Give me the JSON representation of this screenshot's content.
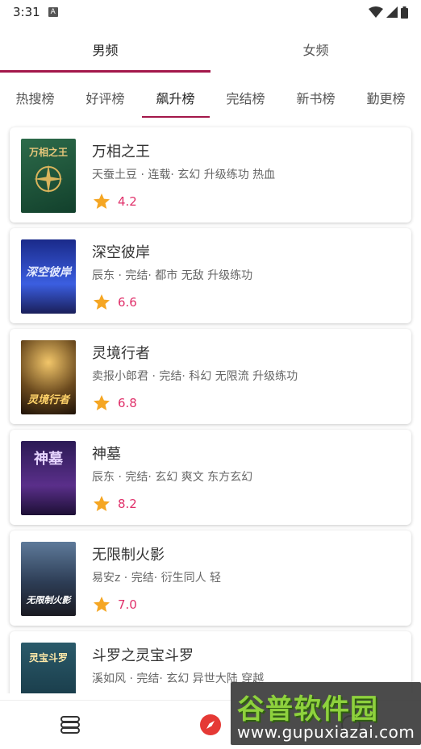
{
  "status_bar": {
    "time": "3:31",
    "notification_letter": "A"
  },
  "gender_tabs": [
    {
      "label": "男频",
      "active": true
    },
    {
      "label": "女频",
      "active": false
    }
  ],
  "rank_tabs": [
    {
      "label": "热搜榜",
      "active": false
    },
    {
      "label": "好评榜",
      "active": false
    },
    {
      "label": "飙升榜",
      "active": true
    },
    {
      "label": "完结榜",
      "active": false
    },
    {
      "label": "新书榜",
      "active": false
    },
    {
      "label": "勤更榜",
      "active": false
    }
  ],
  "books": [
    {
      "title": "万相之王",
      "meta": "天蚕土豆 · 连载· 玄幻 升级练功 热血",
      "score": "4.2",
      "cover_text": "万相之王"
    },
    {
      "title": "深空彼岸",
      "meta": "辰东 · 完结· 都市 无敌 升级练功",
      "score": "6.6",
      "cover_text": "深空彼岸"
    },
    {
      "title": "灵境行者",
      "meta": "卖报小郎君 · 完结· 科幻 无限流 升级练功",
      "score": "6.8",
      "cover_text": "灵境行者"
    },
    {
      "title": "神墓",
      "meta": "辰东 · 完结· 玄幻 爽文 东方玄幻",
      "score": "8.2",
      "cover_text": "神墓"
    },
    {
      "title": "无限制火影",
      "meta": "易安z · 完结· 衍生同人 轻",
      "score": "7.0",
      "cover_text": "无限制火影"
    },
    {
      "title": "斗罗之灵宝斗罗",
      "meta": "溪如风 · 完结· 玄幻 异世大陆 穿越",
      "score": "",
      "cover_text": "灵宝斗罗"
    }
  ],
  "watermark": {
    "brand": "谷普软件园",
    "url": "www.gupuxiazai.com"
  },
  "colors": {
    "accent": "#a3174a",
    "score": "#e0306a",
    "star": "#f5a623"
  }
}
